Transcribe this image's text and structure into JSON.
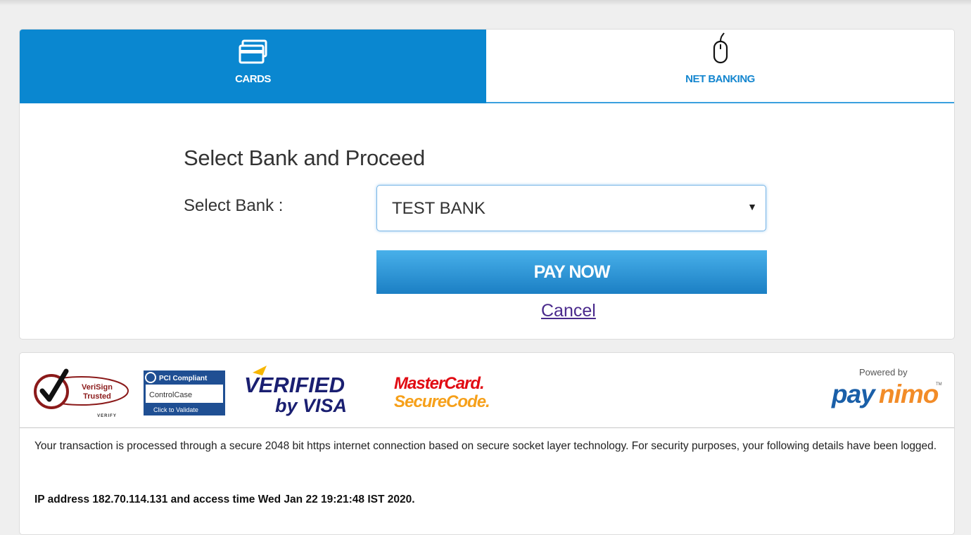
{
  "tabs": [
    {
      "label": "CARDS",
      "icon": "card-icon",
      "active": true
    },
    {
      "label": "NET BANKING",
      "icon": "mouse-icon",
      "active": false
    }
  ],
  "form": {
    "heading": "Select Bank and Proceed",
    "bank_label": "Select Bank :",
    "bank_selected": "TEST BANK",
    "pay_label": "PAY NOW",
    "cancel_label": "Cancel"
  },
  "badges": {
    "verisign_line1": "VeriSign",
    "verisign_line2": "Trusted",
    "verisign_sub": "VERIFY",
    "pci_line1": "PCI Compliant",
    "pci_line2": "ControlCase",
    "pci_line3": "Click to Validate",
    "vbv_line1": "VERIFIED",
    "vbv_line2": "by VISA",
    "mc_line1": "MasterCard.",
    "mc_line2": "SecureCode.",
    "powered_by": "Powered by",
    "brand_pay": "pay",
    "brand_nimo": "nimo",
    "brand_tm": "TM"
  },
  "footer": {
    "secure_text": "Your transaction is processed through a secure 2048 bit https internet connection based on secure socket layer technology. For security purposes, your following details have been logged.",
    "ip_text": "IP address 182.70.114.131 and access time Wed Jan 22 19:21:48 IST 2020."
  },
  "colors": {
    "accent": "#0a87d0",
    "pay_button": "#1b7fc4",
    "link": "#4a2a8c"
  }
}
